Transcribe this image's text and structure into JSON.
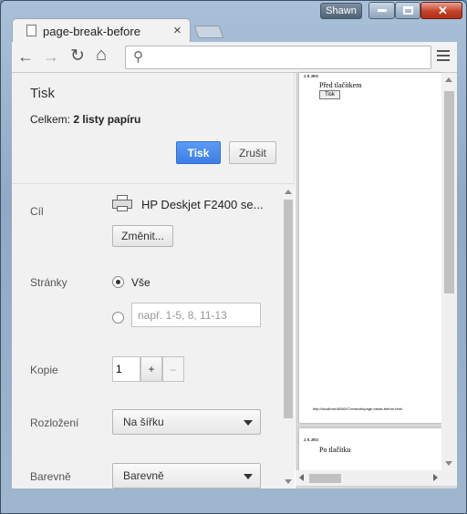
{
  "titlebar": {
    "user": "Shawn"
  },
  "tab": {
    "title": "page-break-before",
    "close": "×"
  },
  "toolbar": {
    "back": "←",
    "forward": "→",
    "reload": "↻",
    "home": "⌂",
    "search_glyph": "⚲",
    "omnibox_value": ""
  },
  "print": {
    "title": "Tisk",
    "total_prefix": "Celkem:",
    "total_value": "2 listy papíru",
    "print_button": "Tisk",
    "cancel_button": "Zrušit"
  },
  "settings": {
    "destination_label": "Cíl",
    "printer_name": "HP Deskjet F2400 se...",
    "change_button": "Změnit...",
    "pages_label": "Stránky",
    "pages_all": "Vše",
    "pages_placeholder": "např. 1-5, 8, 11-13",
    "copies_label": "Kopie",
    "copies_value": "1",
    "copies_plus": "+",
    "copies_minus": "–",
    "layout_label": "Rozložení",
    "layout_value": "Na šířku",
    "color_label": "Barevně",
    "color_value": "Barevně"
  },
  "preview": {
    "page1_date": "2. 8. 2015",
    "page1_text": "Před tlačítkem",
    "page1_button": "Tisk",
    "page1_url": "http://localhost:8080/IT.network/page-break-before.html",
    "page2_date": "2. 8. 2015",
    "page2_text": "Po tlačítku"
  }
}
